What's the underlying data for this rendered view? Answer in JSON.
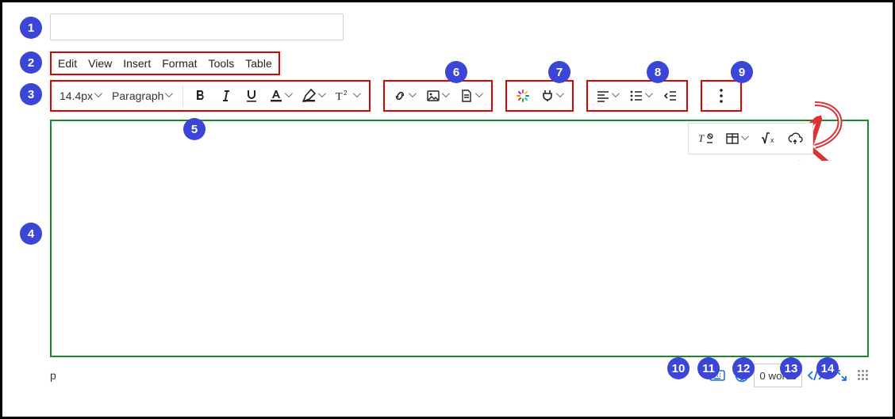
{
  "badges": [
    "1",
    "2",
    "3",
    "4",
    "5",
    "6",
    "7",
    "8",
    "9",
    "10",
    "11",
    "12",
    "13",
    "14"
  ],
  "title_value": "",
  "menubar": {
    "items": [
      "Edit",
      "View",
      "Insert",
      "Format",
      "Tools",
      "Table"
    ]
  },
  "toolbar": {
    "font_size": "14.4px",
    "block_format": "Paragraph"
  },
  "overflow": {
    "items": [
      "clear-formatting",
      "table",
      "equation",
      "embed"
    ]
  },
  "status": {
    "path": "p",
    "word_count": "0 words"
  }
}
